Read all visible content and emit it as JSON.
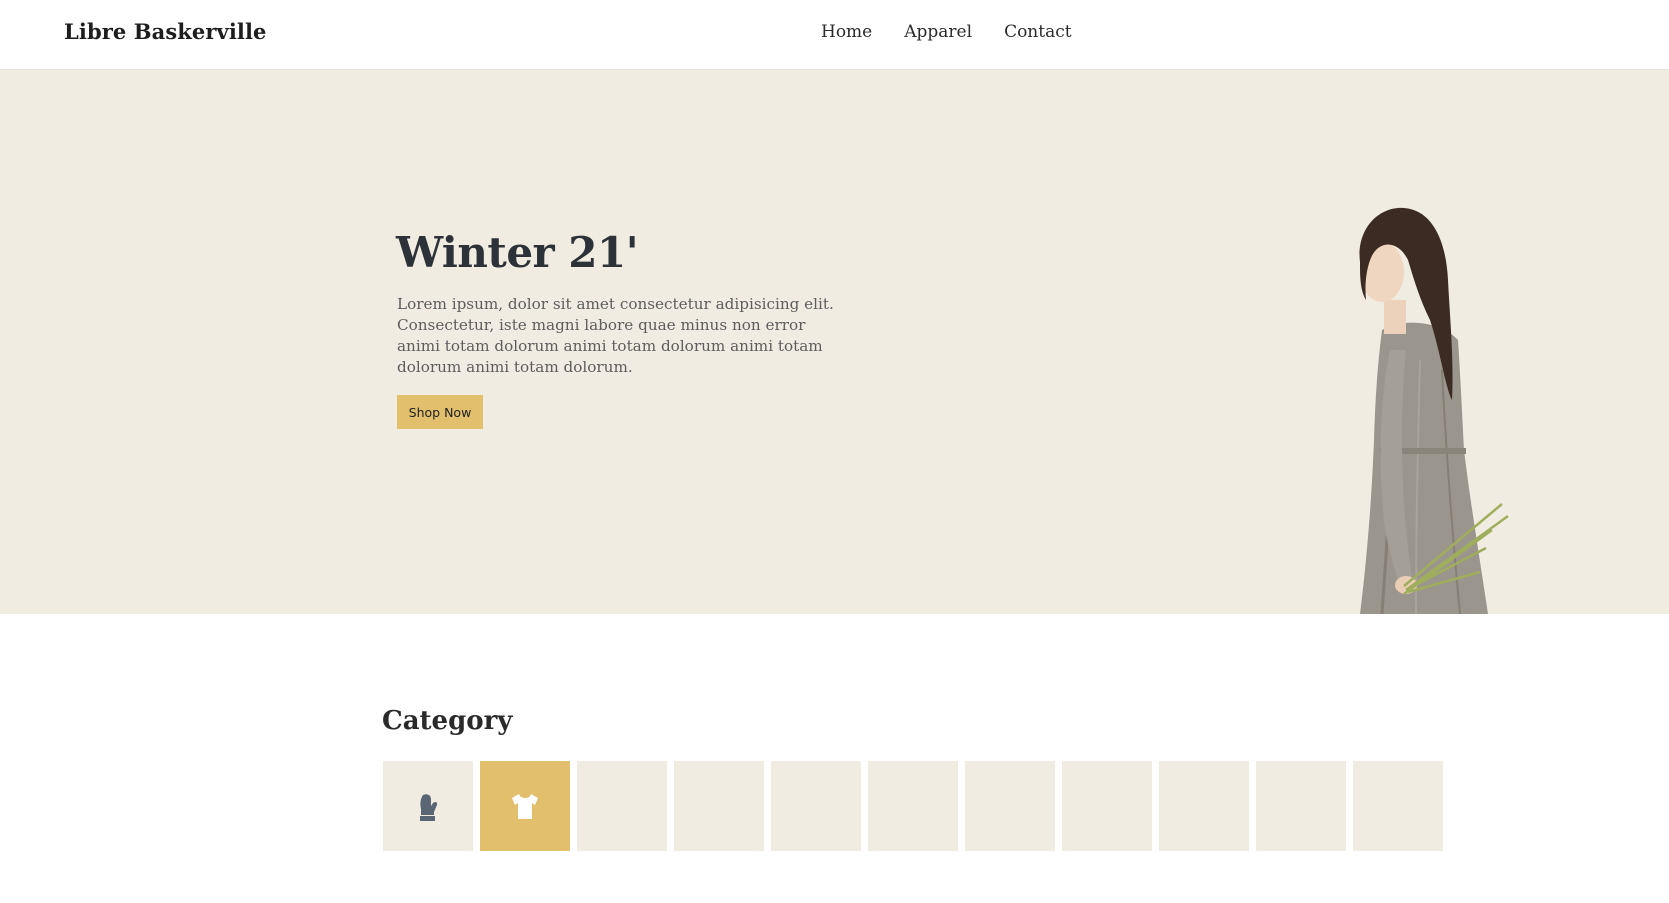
{
  "header": {
    "brand": "Libre Baskerville",
    "nav": [
      {
        "label": "Home"
      },
      {
        "label": "Apparel"
      },
      {
        "label": "Contact"
      }
    ]
  },
  "hero": {
    "title": "Winter 21'",
    "text": "Lorem ipsum, dolor sit amet consectetur adipisicing elit. Consectetur, iste magni labore quae minus non error animi totam dolorum animi totam dolorum animi totam dolorum animi totam dolorum.",
    "button": "Shop Now",
    "image": "woman-in-grey-dress-with-flowers"
  },
  "category": {
    "title": "Category",
    "tiles": [
      {
        "icon": "mitten-icon",
        "active": false
      },
      {
        "icon": "tshirt-icon",
        "active": true
      },
      {
        "icon": "",
        "active": false
      },
      {
        "icon": "",
        "active": false
      },
      {
        "icon": "",
        "active": false
      },
      {
        "icon": "",
        "active": false
      },
      {
        "icon": "",
        "active": false
      },
      {
        "icon": "",
        "active": false
      },
      {
        "icon": "",
        "active": false
      },
      {
        "icon": "",
        "active": false
      },
      {
        "icon": "",
        "active": false
      }
    ]
  },
  "colors": {
    "accent": "#e2bf6d",
    "hero_background": "#f1ece2",
    "heading": "#2d3238"
  }
}
